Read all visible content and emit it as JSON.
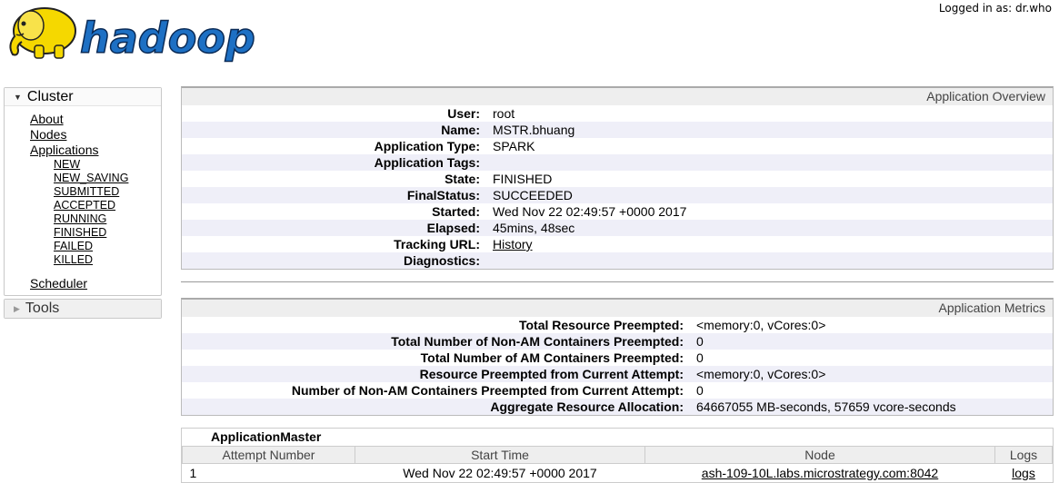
{
  "header": {
    "logo_text": "hadoop",
    "logged_in": "Logged in as: dr.who"
  },
  "nav": {
    "cluster": {
      "label": "Cluster",
      "items": [
        "About",
        "Nodes",
        "Applications"
      ],
      "app_states": [
        "NEW",
        "NEW_SAVING",
        "SUBMITTED",
        "ACCEPTED",
        "RUNNING",
        "FINISHED",
        "FAILED",
        "KILLED"
      ],
      "scheduler": "Scheduler"
    },
    "tools": {
      "label": "Tools"
    }
  },
  "overview": {
    "title": "Application Overview",
    "rows": [
      {
        "key": "User:",
        "value": "root"
      },
      {
        "key": "Name:",
        "value": "MSTR.bhuang"
      },
      {
        "key": "Application Type:",
        "value": "SPARK"
      },
      {
        "key": "Application Tags:",
        "value": ""
      },
      {
        "key": "State:",
        "value": "FINISHED"
      },
      {
        "key": "FinalStatus:",
        "value": "SUCCEEDED"
      },
      {
        "key": "Started:",
        "value": "Wed Nov 22 02:49:57 +0000 2017"
      },
      {
        "key": "Elapsed:",
        "value": "45mins, 48sec"
      },
      {
        "key": "Tracking URL:",
        "value": "History"
      },
      {
        "key": "Diagnostics:",
        "value": ""
      }
    ]
  },
  "metrics": {
    "title": "Application Metrics",
    "rows": [
      {
        "key": "Total Resource Preempted:",
        "value": "<memory:0, vCores:0>"
      },
      {
        "key": "Total Number of Non-AM Containers Preempted:",
        "value": "0"
      },
      {
        "key": "Total Number of AM Containers Preempted:",
        "value": "0"
      },
      {
        "key": "Resource Preempted from Current Attempt:",
        "value": "<memory:0, vCores:0>"
      },
      {
        "key": "Number of Non-AM Containers Preempted from Current Attempt:",
        "value": "0"
      },
      {
        "key": "Aggregate Resource Allocation:",
        "value": "64667055 MB-seconds, 57659 vcore-seconds"
      }
    ]
  },
  "app_master": {
    "title": "ApplicationMaster",
    "columns": [
      "Attempt Number",
      "Start Time",
      "Node",
      "Logs"
    ],
    "rows": [
      {
        "attempt": "1",
        "start": "Wed Nov 22 02:49:57 +0000 2017",
        "node": "ash-109-10L.labs.microstrategy.com:8042",
        "logs": "logs"
      }
    ]
  },
  "colors": {
    "logo_yellow": "#f5d800",
    "logo_blue": "#1d70c4",
    "row_alt": "#efeff8"
  }
}
